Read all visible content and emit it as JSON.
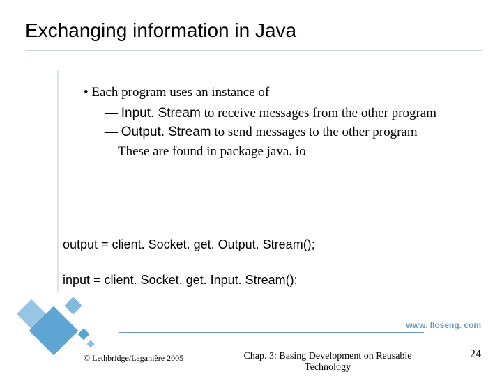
{
  "title": "Exchanging information in Java",
  "bullets": {
    "main": "Each program uses an instance of",
    "sub1_pre": "— ",
    "sub1_code": "Input. Stream",
    "sub1_rest": " to receive messages from the other program",
    "sub2_pre": "— ",
    "sub2_code": "Output. Stream",
    "sub2_rest": " to send messages to the other program",
    "sub3_pre": "—These are found in package ",
    "sub3_code": "java. io"
  },
  "code": {
    "line1": "output = client. Socket. get. Output. Stream();",
    "line2": "input = client. Socket. get. Input. Stream();"
  },
  "url": "www. lloseng. com",
  "footer": {
    "copyright": "© Lethbridge/Laganière 2005",
    "chapter": "Chap. 3: Basing Development on Reusable Technology",
    "page": "24"
  }
}
